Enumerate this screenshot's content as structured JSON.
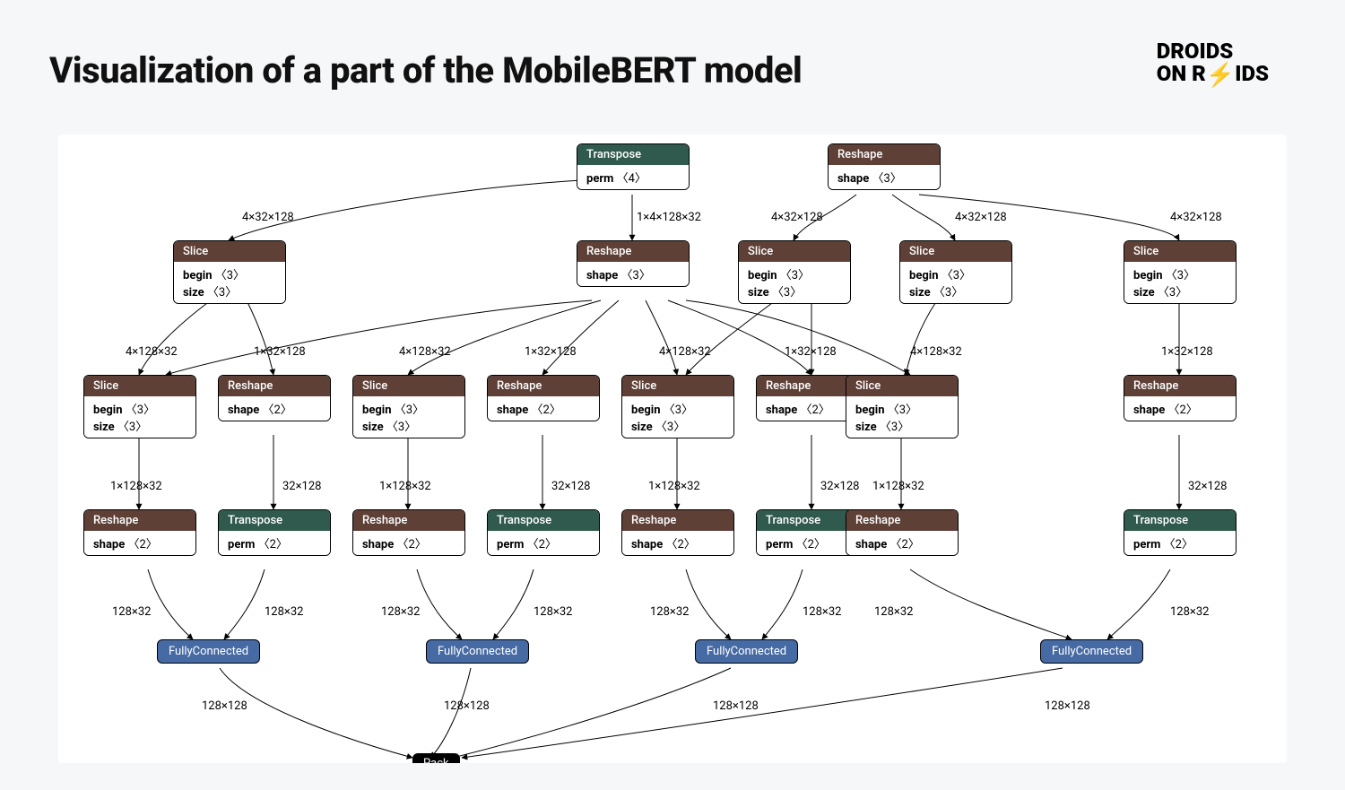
{
  "title": "Visualization of a part of the MobileBERT model",
  "logo": {
    "line1": "DROIDS",
    "line2a": "ON R",
    "bolt": "⚡",
    "line2b": "IDS"
  },
  "ops": {
    "transpose": "Transpose",
    "reshape": "Reshape",
    "slice": "Slice",
    "fc": "FullyConnected",
    "pack": "Pack"
  },
  "attrs": {
    "perm": "perm",
    "shape": "shape",
    "begin": "begin",
    "size": "size"
  },
  "shapes": {
    "s4": "〈4〉",
    "s3": "〈3〉",
    "s2": "〈2〉"
  },
  "dims": {
    "d4x32x128": "4×32×128",
    "d1x4x128x32": "1×4×128×32",
    "d4x128x32": "4×128×32",
    "d1x32x128": "1×32×128",
    "d1x128x32": "1×128×32",
    "d32x128": "32×128",
    "d128x32": "128×32",
    "d128x128": "128×128"
  }
}
